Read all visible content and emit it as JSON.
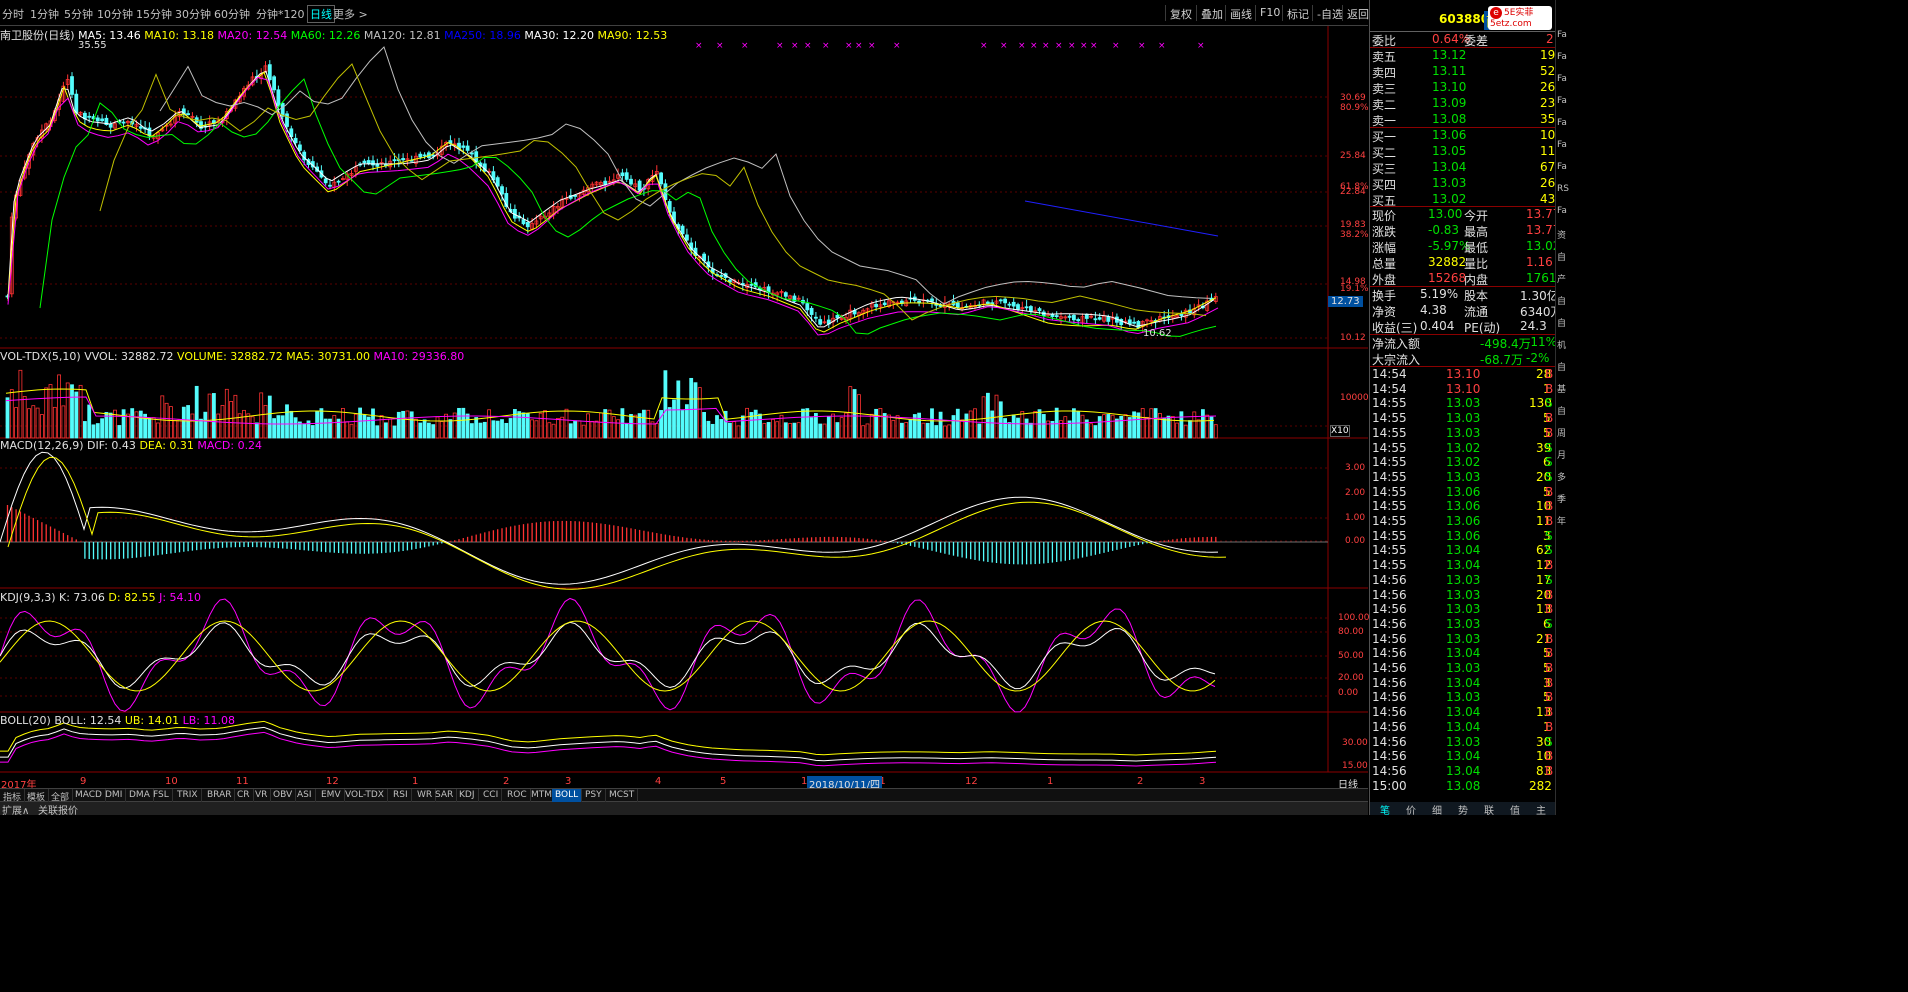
{
  "toolbar": {
    "periods": [
      "分时",
      "1分钟",
      "5分钟",
      "10分钟",
      "15分钟",
      "30分钟",
      "60分钟",
      "分钟*120",
      "日线",
      "更多 >"
    ],
    "active_period": "日线",
    "buttons": [
      "复权",
      "叠加",
      "画线",
      "F10",
      "标记",
      "-自选",
      "返回"
    ]
  },
  "price_panel": {
    "title": "南卫股份(日线)",
    "ma": [
      {
        "label": "MA5: 13.46",
        "color": "#ffffff"
      },
      {
        "label": "MA10: 13.18",
        "color": "#ffff00"
      },
      {
        "label": "MA20: 12.54",
        "color": "#ff00ff"
      },
      {
        "label": "MA60: 12.26",
        "color": "#00ff00"
      },
      {
        "label": "MA120: 12.81",
        "color": "#c0c0c0"
      },
      {
        "label": "MA250: 18.96",
        "color": "#0000ff"
      },
      {
        "label": "MA30: 12.20",
        "color": "#ffffff"
      },
      {
        "label": "MA90: 12.53",
        "color": "#ffff00"
      }
    ],
    "high_label": "35.55",
    "low_label": "10.62",
    "current_price": "12.73",
    "axis_labels": [
      "30.69",
      "80.9%",
      "25.84",
      "61.8%",
      "22.84",
      "19.83",
      "38.2%",
      "14.98",
      "19.1%",
      "10.12"
    ]
  },
  "volume_panel": {
    "title": "VOL-TDX(5,10)",
    "vvol": "VVOL: 32882.72",
    "volume": "VOLUME: 32882.72",
    "ma5": "MA5: 30731.00",
    "ma10": "MA10: 29336.80",
    "axis_labels": [
      "10000",
      "X10"
    ]
  },
  "macd_panel": {
    "title": "MACD(12,26,9)",
    "dif": "DIF: 0.43",
    "dea": "DEA: 0.31",
    "macd": "MACD: 0.24",
    "axis_labels": [
      "3.00",
      "2.00",
      "1.00",
      "0.00"
    ]
  },
  "kdj_panel": {
    "title": "KDJ(9,3,3)",
    "k": "K: 73.06",
    "d": "D: 82.55",
    "j": "J: 54.10",
    "axis_labels": [
      "100.00",
      "80.00",
      "50.00",
      "20.00",
      "0.00"
    ]
  },
  "boll_panel": {
    "title": "BOLL(20)",
    "boll": "BOLL: 12.54",
    "ub": "UB: 14.01",
    "lb": "LB: 11.08",
    "axis_labels": [
      "30.00",
      "15.00"
    ]
  },
  "date_axis": {
    "labels": [
      "2017年",
      "9",
      "10",
      "11",
      "12",
      "1",
      "2",
      "3",
      "4",
      "5",
      "10",
      "11",
      "12",
      "1",
      "2",
      "3"
    ],
    "cursor_date": "2018/10/11/四",
    "period_label": "日线"
  },
  "indicator_tabs": [
    "指标",
    "模板",
    "全部",
    "MACD",
    "DMI",
    "DMA",
    "FSL",
    "TRIX",
    "BRAR",
    "CR",
    "VR",
    "OBV",
    "ASI",
    "EMV",
    "VOL-TDX",
    "RSI",
    "WR",
    "SAR",
    "KDJ",
    "CCI",
    "ROC",
    "MTM",
    "BOLL",
    "PSY",
    "MCST"
  ],
  "active_indicator": "BOLL",
  "bottom_bar": {
    "expand": "扩展∧",
    "related": "关联报价"
  },
  "quote": {
    "code": "603880",
    "name": "南卫",
    "logo": "5E实菲 5etz.com",
    "weibi": {
      "label": "委比",
      "value": "0.64%",
      "label2": "委差",
      "value2": "2"
    },
    "asks": [
      {
        "label": "卖五",
        "price": "13.12",
        "vol": "19"
      },
      {
        "label": "卖四",
        "price": "13.11",
        "vol": "52"
      },
      {
        "label": "卖三",
        "price": "13.10",
        "vol": "26"
      },
      {
        "label": "卖二",
        "price": "13.09",
        "vol": "23"
      },
      {
        "label": "卖一",
        "price": "13.08",
        "vol": "35"
      }
    ],
    "bids": [
      {
        "label": "买一",
        "price": "13.06",
        "vol": "10"
      },
      {
        "label": "买二",
        "price": "13.05",
        "vol": "11"
      },
      {
        "label": "买三",
        "price": "13.04",
        "vol": "67"
      },
      {
        "label": "买四",
        "price": "13.03",
        "vol": "26"
      },
      {
        "label": "买五",
        "price": "13.02",
        "vol": "43"
      }
    ],
    "stats": [
      {
        "l1": "现价",
        "v1": "13.00",
        "c1": "#00e000",
        "l2": "今开",
        "v2": "13.77",
        "c2": "#ff4040"
      },
      {
        "l1": "涨跌",
        "v1": "-0.83",
        "c1": "#00e000",
        "l2": "最高",
        "v2": "13.77",
        "c2": "#ff4040"
      },
      {
        "l1": "涨幅",
        "v1": "-5.97%",
        "c1": "#00e000",
        "l2": "最低",
        "v2": "13.02",
        "c2": "#00e000"
      },
      {
        "l1": "总量",
        "v1": "32882",
        "c1": "#ffff00",
        "l2": "量比",
        "v2": "1.16",
        "c2": "#ff4040"
      },
      {
        "l1": "外盘",
        "v1": "15268",
        "c1": "#ff4040",
        "l2": "内盘",
        "v2": "17614",
        "c2": "#00e000"
      }
    ],
    "stats2": [
      {
        "l1": "换手",
        "v1": "5.19%",
        "l2": "股本",
        "v2": "1.30亿"
      },
      {
        "l1": "净资",
        "v1": "4.38",
        "l2": "流通",
        "v2": "6340万"
      },
      {
        "l1": "收益(三)",
        "v1": "0.404",
        "l2": "PE(动)",
        "v2": "24.3"
      }
    ],
    "flows": [
      {
        "label": "净流入额",
        "value": "-498.4万",
        "pct": "-11%"
      },
      {
        "label": "大宗流入",
        "value": "-68.7万",
        "pct": "-2%"
      }
    ],
    "ticks": [
      {
        "t": "14:54",
        "p": "13.10",
        "c": "r",
        "v": "28",
        "s": "B"
      },
      {
        "t": "14:54",
        "p": "13.10",
        "c": "r",
        "v": "1",
        "s": "B"
      },
      {
        "t": "14:55",
        "p": "13.03",
        "c": "g",
        "v": "130",
        "s": "S"
      },
      {
        "t": "14:55",
        "p": "13.03",
        "c": "g",
        "v": "5",
        "s": "B"
      },
      {
        "t": "14:55",
        "p": "13.03",
        "c": "g",
        "v": "5",
        "s": "B"
      },
      {
        "t": "14:55",
        "p": "13.02",
        "c": "g",
        "v": "39",
        "s": "S"
      },
      {
        "t": "14:55",
        "p": "13.02",
        "c": "g",
        "v": "6",
        "s": "S"
      },
      {
        "t": "14:55",
        "p": "13.03",
        "c": "g",
        "v": "20",
        "s": "S"
      },
      {
        "t": "14:55",
        "p": "13.06",
        "c": "g",
        "v": "5",
        "s": "B"
      },
      {
        "t": "14:55",
        "p": "13.06",
        "c": "g",
        "v": "10",
        "s": "B"
      },
      {
        "t": "14:55",
        "p": "13.06",
        "c": "g",
        "v": "11",
        "s": "B"
      },
      {
        "t": "14:55",
        "p": "13.06",
        "c": "g",
        "v": "3",
        "s": "S"
      },
      {
        "t": "14:55",
        "p": "13.04",
        "c": "g",
        "v": "62",
        "s": "S"
      },
      {
        "t": "14:55",
        "p": "13.04",
        "c": "g",
        "v": "12",
        "s": "B"
      },
      {
        "t": "14:56",
        "p": "13.03",
        "c": "g",
        "v": "17",
        "s": "S"
      },
      {
        "t": "14:56",
        "p": "13.03",
        "c": "g",
        "v": "20",
        "s": "B"
      },
      {
        "t": "14:56",
        "p": "13.03",
        "c": "g",
        "v": "13",
        "s": "B"
      },
      {
        "t": "14:56",
        "p": "13.03",
        "c": "g",
        "v": "6",
        "s": "S"
      },
      {
        "t": "14:56",
        "p": "13.03",
        "c": "g",
        "v": "21",
        "s": "B"
      },
      {
        "t": "14:56",
        "p": "13.04",
        "c": "g",
        "v": "5",
        "s": "B"
      },
      {
        "t": "14:56",
        "p": "13.03",
        "c": "g",
        "v": "5",
        "s": "B"
      },
      {
        "t": "14:56",
        "p": "13.04",
        "c": "g",
        "v": "3",
        "s": "B"
      },
      {
        "t": "14:56",
        "p": "13.03",
        "c": "g",
        "v": "5",
        "s": "B"
      },
      {
        "t": "14:56",
        "p": "13.04",
        "c": "g",
        "v": "13",
        "s": "B"
      },
      {
        "t": "14:56",
        "p": "13.04",
        "c": "g",
        "v": "1",
        "s": "B"
      },
      {
        "t": "14:56",
        "p": "13.03",
        "c": "g",
        "v": "30",
        "s": "S"
      },
      {
        "t": "14:56",
        "p": "13.04",
        "c": "g",
        "v": "10",
        "s": "B"
      },
      {
        "t": "14:56",
        "p": "13.04",
        "c": "g",
        "v": "83",
        "s": "B"
      },
      {
        "t": "15:00",
        "p": "13.08",
        "c": "g",
        "v": "282",
        "s": ""
      }
    ],
    "tabs": [
      "笔",
      "价",
      "细",
      "势",
      "联",
      "值",
      "主"
    ]
  },
  "side_strip": [
    "Fa",
    "Fa",
    "Fa",
    "Fa",
    "Fa",
    "Fa",
    "Fa",
    "RS",
    "Fa",
    "资",
    "自",
    "产",
    "自",
    "自",
    "机",
    "自",
    "基",
    "自",
    "周",
    "月",
    "多",
    "季",
    "年"
  ],
  "colors": {
    "up": "#ff3232",
    "down": "#54fcfc",
    "ma5": "#ffffff",
    "ma10": "#ffff00",
    "ma20": "#ff00ff",
    "ma60": "#00ff00",
    "ma120": "#c0c0c0",
    "ma250": "#2020ff",
    "panel_border": "#8b0000",
    "vol_grid": "#5a0000"
  }
}
